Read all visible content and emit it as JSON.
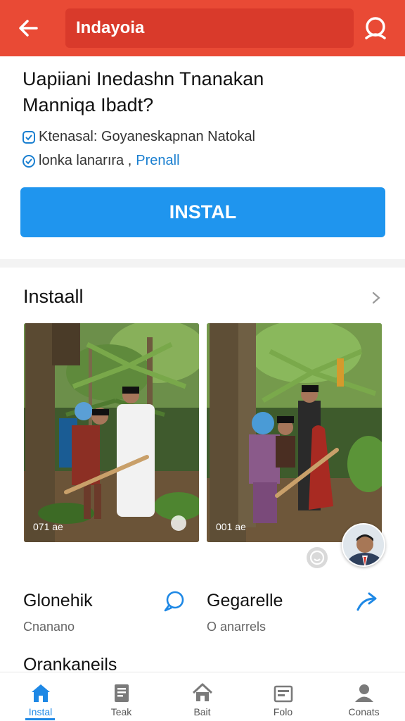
{
  "colors": {
    "header": "#e94a35",
    "accent": "#1f95ee",
    "link": "#1a7fd0"
  },
  "header": {
    "search_text": "Indayoia",
    "back_icon": "arrow-left-icon",
    "search_icon": "search-icon"
  },
  "app_info": {
    "title_line1": "Uapiiani Inedashn Tnanakan",
    "title_line2": "Manniqa Ibadt?",
    "check1": "Ktenasal: Goyaneskapnan Natokal",
    "check2": "lonka lanarıra ,",
    "check2_link": "Prenall",
    "install_label": "INSTAL"
  },
  "gallery": {
    "title": "Instaall",
    "photos": [
      {
        "caption": "071 ae"
      },
      {
        "caption": "001 ae"
      }
    ]
  },
  "items": [
    {
      "title": "Glonehik",
      "subtitle": "Cnanano",
      "icon": "chat-bubble-icon"
    },
    {
      "title": "Gegarelle",
      "subtitle": "O anarrels",
      "icon": "share-arrow-icon"
    }
  ],
  "peek": {
    "title": "Orankaneils"
  },
  "bottom_nav": [
    {
      "label": "Instal",
      "icon": "home-icon",
      "active": true
    },
    {
      "label": "Teak",
      "icon": "document-icon",
      "active": false
    },
    {
      "label": "Bait",
      "icon": "house-icon",
      "active": false
    },
    {
      "label": "Folo",
      "icon": "folder-icon",
      "active": false
    },
    {
      "label": "Conats",
      "icon": "person-icon",
      "active": false
    }
  ]
}
